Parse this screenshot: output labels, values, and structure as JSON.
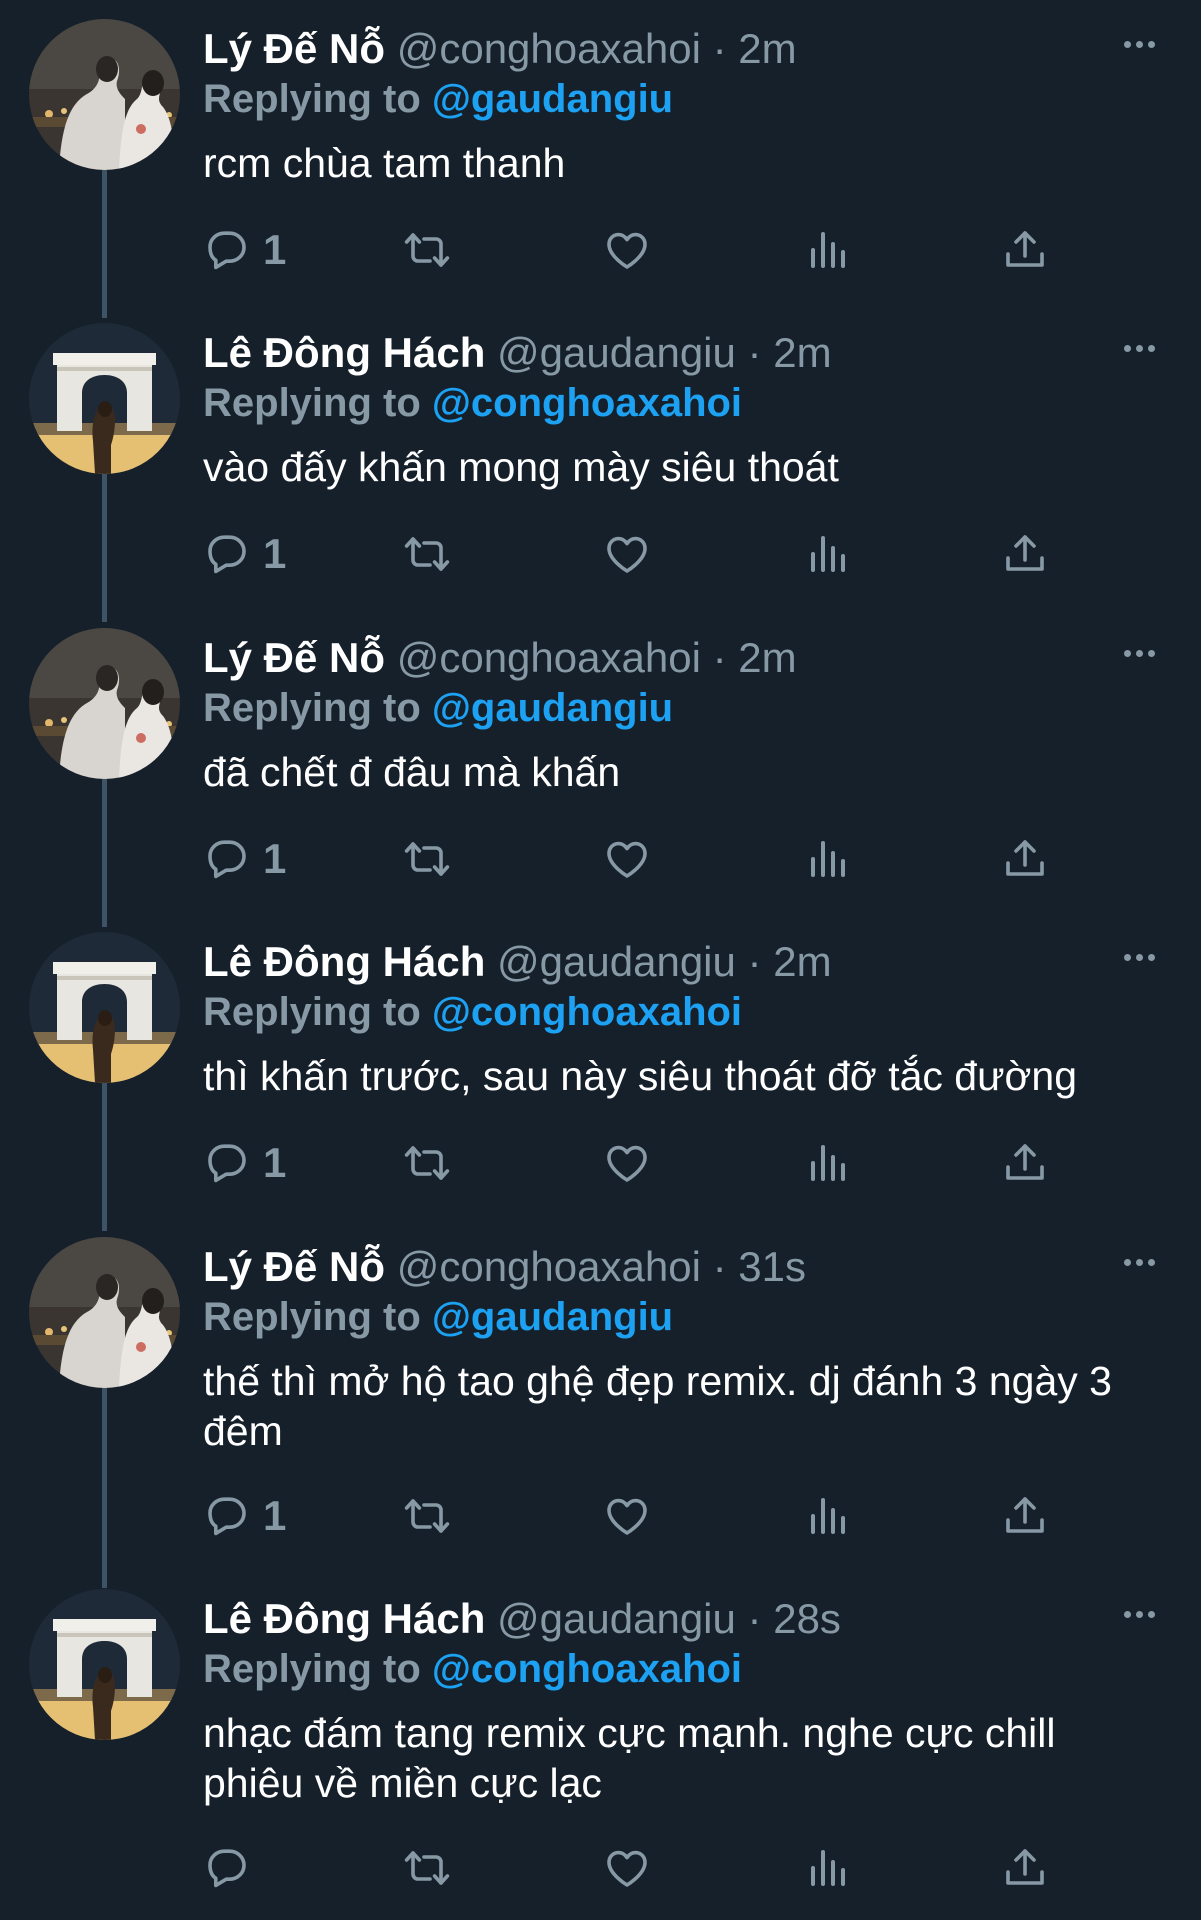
{
  "tweets": [
    {
      "name": "Lý Đế Nỗ",
      "handle": "@conghoaxahoi",
      "dot": "·",
      "time": "2m",
      "replying_label": "Replying to",
      "replying_handle": "@gaudangiu",
      "text": "rcm chùa tam thanh",
      "reply_count": "1",
      "avatar": "couple-photo"
    },
    {
      "name": "Lê Đông Hách",
      "handle": "@gaudangiu",
      "dot": "·",
      "time": "2m",
      "replying_label": "Replying to",
      "replying_handle": "@conghoaxahoi",
      "text": "vào đấy khấn mong mày siêu thoát",
      "reply_count": "1",
      "avatar": "arc-de-triomphe-photo"
    },
    {
      "name": "Lý Đế Nỗ",
      "handle": "@conghoaxahoi",
      "dot": "·",
      "time": "2m",
      "replying_label": "Replying to",
      "replying_handle": "@gaudangiu",
      "text": "đã chết đ đâu mà khấn",
      "reply_count": "1",
      "avatar": "couple-photo"
    },
    {
      "name": "Lê Đông Hách",
      "handle": "@gaudangiu",
      "dot": "·",
      "time": "2m",
      "replying_label": "Replying to",
      "replying_handle": "@conghoaxahoi",
      "text": "thì khấn trước, sau này siêu thoát đỡ tắc đường",
      "reply_count": "1",
      "avatar": "arc-de-triomphe-photo"
    },
    {
      "name": "Lý Đế Nỗ",
      "handle": "@conghoaxahoi",
      "dot": "·",
      "time": "31s",
      "replying_label": "Replying to",
      "replying_handle": "@gaudangiu",
      "text": "thế thì mở hộ tao ghệ đẹp remix. dj đánh 3 ngày 3 đêm",
      "reply_count": "1",
      "avatar": "couple-photo"
    },
    {
      "name": "Lê Đông Hách",
      "handle": "@gaudangiu",
      "dot": "·",
      "time": "28s",
      "replying_label": "Replying to",
      "replying_handle": "@conghoaxahoi",
      "text": "nhạc đám tang remix cực mạnh. nghe cực chill phiêu về miền cực lạc",
      "reply_count": "",
      "avatar": "arc-de-triomphe-photo"
    }
  ],
  "colors": {
    "background": "#15202b",
    "text_primary": "#ffffff",
    "text_secondary": "#8899a6",
    "accent": "#1da1f2",
    "thread_line": "#3d5466"
  },
  "icons": [
    "reply-icon",
    "retweet-icon",
    "like-icon",
    "analytics-icon",
    "share-icon",
    "more-icon"
  ]
}
